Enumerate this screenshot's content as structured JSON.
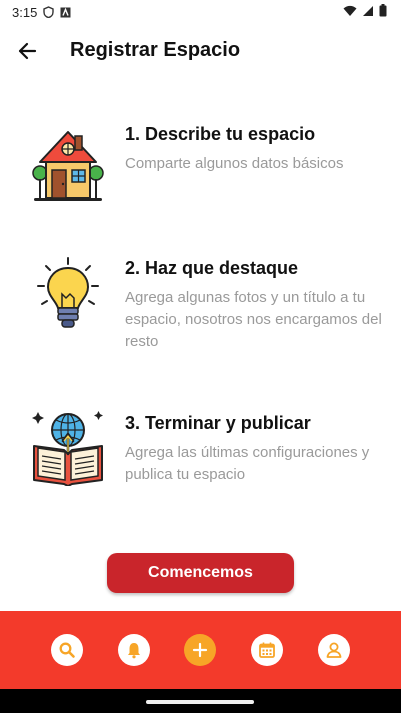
{
  "status": {
    "time": "3:15"
  },
  "header": {
    "title": "Registrar Espacio"
  },
  "steps": [
    {
      "title": "1. Describe tu espacio",
      "description": "Comparte algunos datos básicos",
      "icon": "house-icon"
    },
    {
      "title": "2. Haz que destaque",
      "description": "Agrega algunas fotos y un título a tu espacio, nosotros nos encargamos del resto",
      "icon": "lightbulb-icon"
    },
    {
      "title": "3. Terminar y publicar",
      "description": "Agrega las últimas configuraciones y publica tu espacio",
      "icon": "book-globe-icon"
    }
  ],
  "cta": {
    "label": "Comencemos"
  },
  "bottom_nav": {
    "items": [
      "search-icon",
      "bell-icon",
      "plus-icon",
      "calendar-icon",
      "person-icon"
    ],
    "active": "plus-icon"
  },
  "colors": {
    "accent": "#c9252b",
    "nav_bg": "#f33a2b",
    "active": "#f7a527",
    "muted_text": "#9a9a9a"
  }
}
